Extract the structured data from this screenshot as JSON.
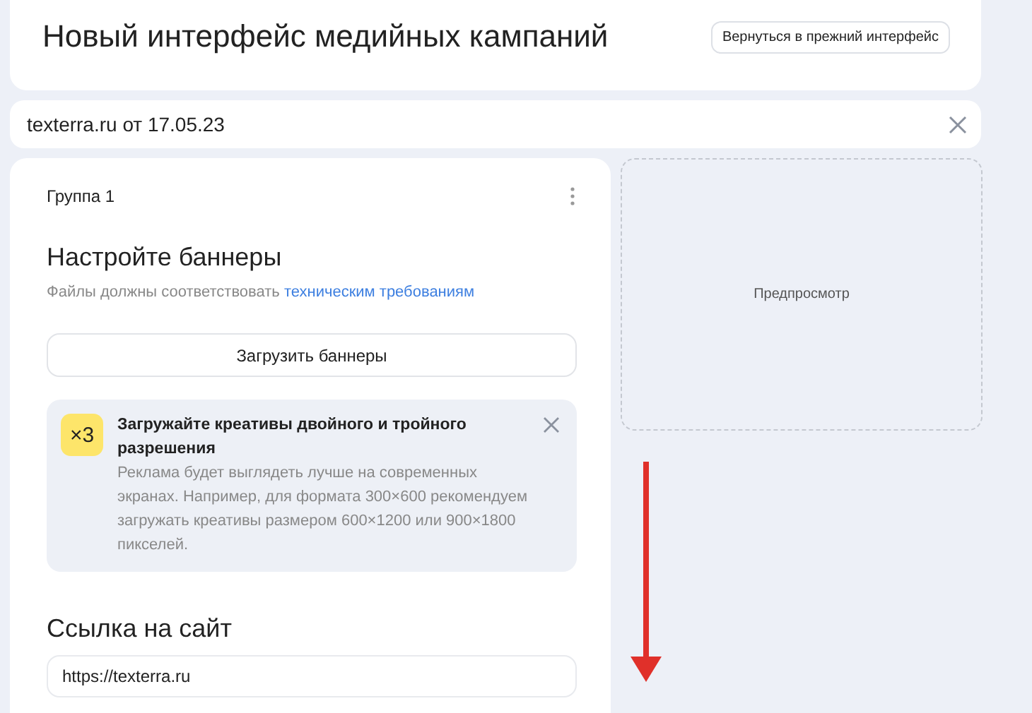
{
  "header": {
    "title": "Новый интерфейс медийных кампаний",
    "back_button": "Вернуться в прежний интерфейс"
  },
  "campaign": {
    "name": "texterra.ru от 17.05.23"
  },
  "group": {
    "name": "Группа 1",
    "heading": "Настройте баннеры",
    "note": "Файлы должны соответствовать",
    "note_link": "техническим требованиям",
    "upload_button": "Загрузить баннеры",
    "tip": {
      "badge": "×3",
      "title": "Загружайте креативы двойного и тройного разрешения",
      "body": "Реклама будет выглядеть лучше на современных экранах. Например, для формата 300×600 рекомендуем загружать креативы размером 600×1200 или 900×1800 пикселей."
    },
    "link_heading": "Ссылка на сайт",
    "link_value": "https://texterra.ru"
  },
  "preview": {
    "label": "Предпросмотр"
  }
}
